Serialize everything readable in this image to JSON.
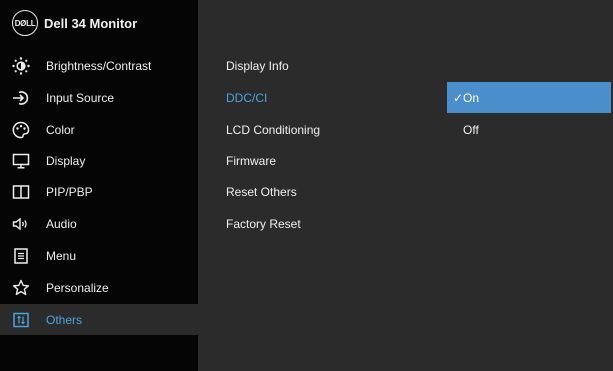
{
  "header": {
    "logo_text": "DØLL",
    "model_name": "Dell 34 Monitor"
  },
  "sidebar": {
    "items": [
      {
        "label": "Brightness/Contrast",
        "icon": "brightness-icon"
      },
      {
        "label": "Input Source",
        "icon": "input-source-icon"
      },
      {
        "label": "Color",
        "icon": "color-palette-icon"
      },
      {
        "label": "Display",
        "icon": "display-icon"
      },
      {
        "label": "PIP/PBP",
        "icon": "pip-pbp-icon"
      },
      {
        "label": "Audio",
        "icon": "speaker-icon"
      },
      {
        "label": "Menu",
        "icon": "menu-icon"
      },
      {
        "label": "Personalize",
        "icon": "star-icon"
      },
      {
        "label": "Others",
        "icon": "others-icon",
        "active": true
      }
    ]
  },
  "submenu": {
    "items": [
      {
        "label": "Display Info"
      },
      {
        "label": "DDC/CI",
        "selected": true
      },
      {
        "label": "LCD Conditioning"
      },
      {
        "label": "Firmware"
      },
      {
        "label": "Reset Others"
      },
      {
        "label": "Factory Reset"
      }
    ]
  },
  "options": {
    "check_mark": "✓",
    "items": [
      {
        "label": "On",
        "selected": true
      },
      {
        "label": "Off"
      }
    ]
  },
  "colors": {
    "accent": "#4aa3df",
    "highlight": "#4a8fcc",
    "sidebar_bg": "#050505",
    "panel_bg": "#2b2b2b"
  }
}
